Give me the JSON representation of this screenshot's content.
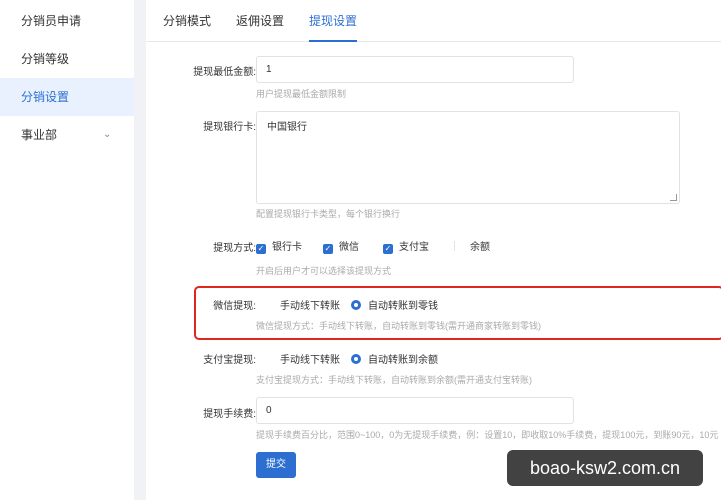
{
  "sidebar": {
    "items": [
      {
        "label": "分销员申请"
      },
      {
        "label": "分销等级"
      },
      {
        "label": "分销设置"
      },
      {
        "label": "事业部",
        "chevron": "chevron-down-icon"
      }
    ]
  },
  "tabs": [
    {
      "label": "分销模式"
    },
    {
      "label": "返佣设置"
    },
    {
      "label": "提现设置"
    }
  ],
  "form": {
    "min_amount": {
      "label": "提现最低金额:",
      "value": "1",
      "hint": "用户提现最低金额限制"
    },
    "bank_card": {
      "label": "提现银行卡:",
      "value": "中国银行",
      "hint": "配置提现银行卡类型，每个银行换行"
    },
    "methods": {
      "label": "提现方式:",
      "options": [
        {
          "label": "银行卡",
          "checked": true
        },
        {
          "label": "微信",
          "checked": true
        },
        {
          "label": "支付宝",
          "checked": true
        },
        {
          "label": "余额",
          "checked": false
        }
      ],
      "hint": "开启后用户才可以选择该提现方式"
    },
    "wechat": {
      "label": "微信提现:",
      "options": [
        {
          "label": "手动线下转账",
          "selected": false
        },
        {
          "label": "自动转账到零钱",
          "selected": true
        }
      ],
      "hint": "微信提现方式：手动线下转账，自动转账到零钱(需开通商家转账到零钱)"
    },
    "alipay": {
      "label": "支付宝提现:",
      "options": [
        {
          "label": "手动线下转账",
          "selected": false
        },
        {
          "label": "自动转账到余额",
          "selected": true
        }
      ],
      "hint": "支付宝提现方式：手动线下转账，自动转账到余额(需开通支付宝转账)"
    },
    "fee": {
      "label": "提现手续费:",
      "value": "0",
      "hint": "提现手续费百分比，范围0~100，0为无提现手续费，例：设置10，即收取10%手续费，提现100元，到账90元，10元"
    },
    "submit_label": "提交"
  },
  "watermark": "boao-ksw2.com.cn",
  "colors": {
    "accent": "#2d6fd1",
    "highlight": "#e0261e",
    "active_bg": "#e8f1fd"
  }
}
